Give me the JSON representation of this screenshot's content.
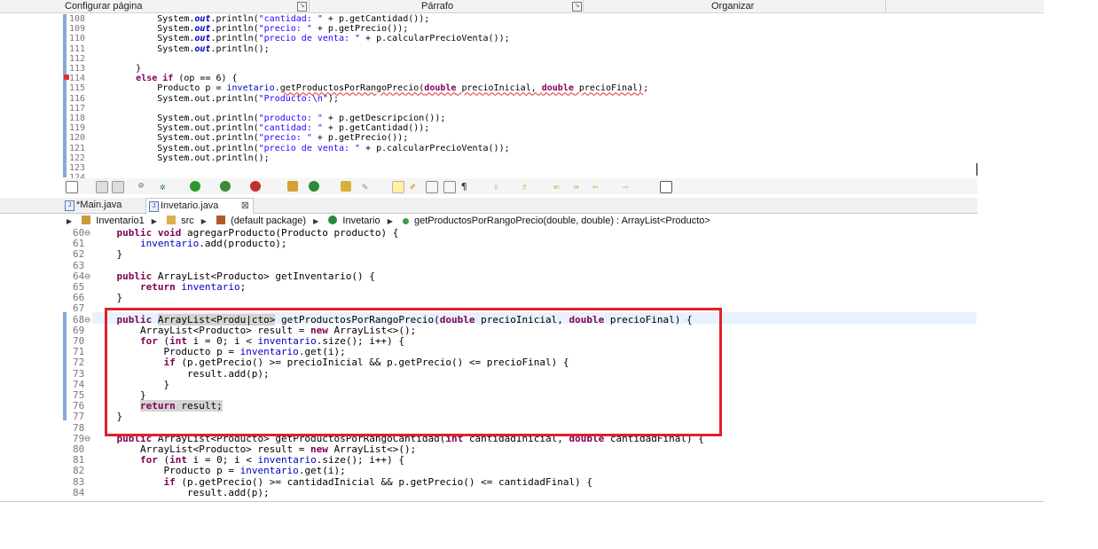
{
  "ribbon": {
    "groups": [
      "Configurar página",
      "Párrafo",
      "Organizar"
    ]
  },
  "top_editor": {
    "lines": [
      {
        "n": "108",
        "html": "            System.<span class='fi'>out</span>.println(<span class='st'>\"cantidad: \"</span> + p.getCantidad());"
      },
      {
        "n": "109",
        "html": "            System.<span class='fi'>out</span>.println(<span class='st'>\"precio: \"</span> + p.getPrecio());"
      },
      {
        "n": "110",
        "html": "            System.<span class='fi'>out</span>.println(<span class='st'>\"precio de venta: \"</span> + p.calcularPrecioVenta());"
      },
      {
        "n": "111",
        "html": "            System.<span class='fi'>out</span>.println();"
      },
      {
        "n": "112",
        "html": ""
      },
      {
        "n": "113",
        "html": "        }"
      },
      {
        "n": "114",
        "html": "        <span class='kw'>else if</span> (op == 6) {"
      },
      {
        "n": "115",
        "html": "            Producto p = <span class='fd'>invetario</span>.<span class='err'>getProductosPorRangoPrecio(<span class='kw'>double</span> precioInicial, <span class='kw'>double</span> precioFinal)</span>;"
      },
      {
        "n": "116",
        "html": "            System.out.println(<span class='st'>\"Producto:\\n\"</span>);"
      },
      {
        "n": "117",
        "html": ""
      },
      {
        "n": "118",
        "html": "            System.out.println(<span class='st'>\"producto: \"</span> + p.getDescripcion());"
      },
      {
        "n": "119",
        "html": "            System.out.println(<span class='st'>\"cantidad: \"</span> + p.getCantidad());"
      },
      {
        "n": "120",
        "html": "            System.out.println(<span class='st'>\"precio: \"</span> + p.getPrecio());"
      },
      {
        "n": "121",
        "html": "            System.out.println(<span class='st'>\"precio de venta: \"</span> + p.calcularPrecioVenta());"
      },
      {
        "n": "122",
        "html": "            System.out.println();"
      },
      {
        "n": "123",
        "html": ""
      },
      {
        "n": "124",
        "html": ""
      }
    ]
  },
  "tabs": [
    {
      "label": "*Main.java",
      "active": false
    },
    {
      "label": "Invetario.java",
      "active": true,
      "close": "⊠"
    }
  ],
  "breadcrumb": [
    "Inventario1",
    "src",
    "(default package)",
    "Invetario",
    "getProductosPorRangoPrecio(double, double) : ArrayList<Producto>"
  ],
  "bottom_editor": {
    "lines": [
      {
        "n": "60⊖",
        "html": "    <span class='kw'>public void</span> agregarProducto(Producto producto) {"
      },
      {
        "n": "61",
        "html": "        <span class='fd'>inventario</span>.add(producto);"
      },
      {
        "n": "62",
        "html": "    }"
      },
      {
        "n": "63",
        "html": ""
      },
      {
        "n": "64⊖",
        "html": "    <span class='kw'>public</span> ArrayList&lt;Producto&gt; getInventario() {"
      },
      {
        "n": "65",
        "html": "        <span class='kw'>return</span> <span class='fd'>inventario</span>;"
      },
      {
        "n": "66",
        "html": "    }"
      },
      {
        "n": "67",
        "html": ""
      },
      {
        "n": "68⊖",
        "html": "    <span class='kw'>public</span> <span class='hl'>ArrayList&lt;Produ|cto&gt;</span> getProductosPorRangoPrecio(<span class='kw'>double</span> precioInicial, <span class='kw'>double</span> precioFinal) {"
      },
      {
        "n": "69",
        "html": "        ArrayList&lt;Producto&gt; result = <span class='kw'>new</span> ArrayList&lt;&gt;();"
      },
      {
        "n": "70",
        "html": "        <span class='kw'>for</span> (<span class='kw'>int</span> i = 0; i &lt; <span class='fd'>inventario</span>.size(); i++) {"
      },
      {
        "n": "71",
        "html": "            Producto p = <span class='fd'>inventario</span>.get(i);"
      },
      {
        "n": "72",
        "html": "            <span class='kw'>if</span> (p.getPrecio() &gt;= precioInicial &amp;&amp; p.getPrecio() &lt;= precioFinal) {"
      },
      {
        "n": "73",
        "html": "                result.add(p);"
      },
      {
        "n": "74",
        "html": "            }"
      },
      {
        "n": "75",
        "html": "        }"
      },
      {
        "n": "76",
        "html": "        <span class='hl'><span class='kw'>return</span> result;</span>"
      },
      {
        "n": "77",
        "html": "    }"
      },
      {
        "n": "78",
        "html": ""
      },
      {
        "n": "79⊖",
        "html": "    <span class='kw'>public</span> ArrayList&lt;Producto&gt; getProductosPorRangoCantidad(<span class='kw'>int</span> cantidadInicial, <span class='kw'>double</span> cantidadFinal) {"
      },
      {
        "n": "80",
        "html": "        ArrayList&lt;Producto&gt; result = <span class='kw'>new</span> ArrayList&lt;&gt;();"
      },
      {
        "n": "81",
        "html": "        <span class='kw'>for</span> (<span class='kw'>int</span> i = 0; i &lt; <span class='fd'>inventario</span>.size(); i++) {"
      },
      {
        "n": "82",
        "html": "            Producto p = <span class='fd'>inventario</span>.get(i);"
      },
      {
        "n": "83",
        "html": "            <span class='kw'>if</span> (p.getPrecio() &gt;= cantidadInicial &amp;&amp; p.getPrecio() &lt;= cantidadFinal) {"
      },
      {
        "n": "84",
        "html": "                result.add(p);"
      }
    ]
  }
}
